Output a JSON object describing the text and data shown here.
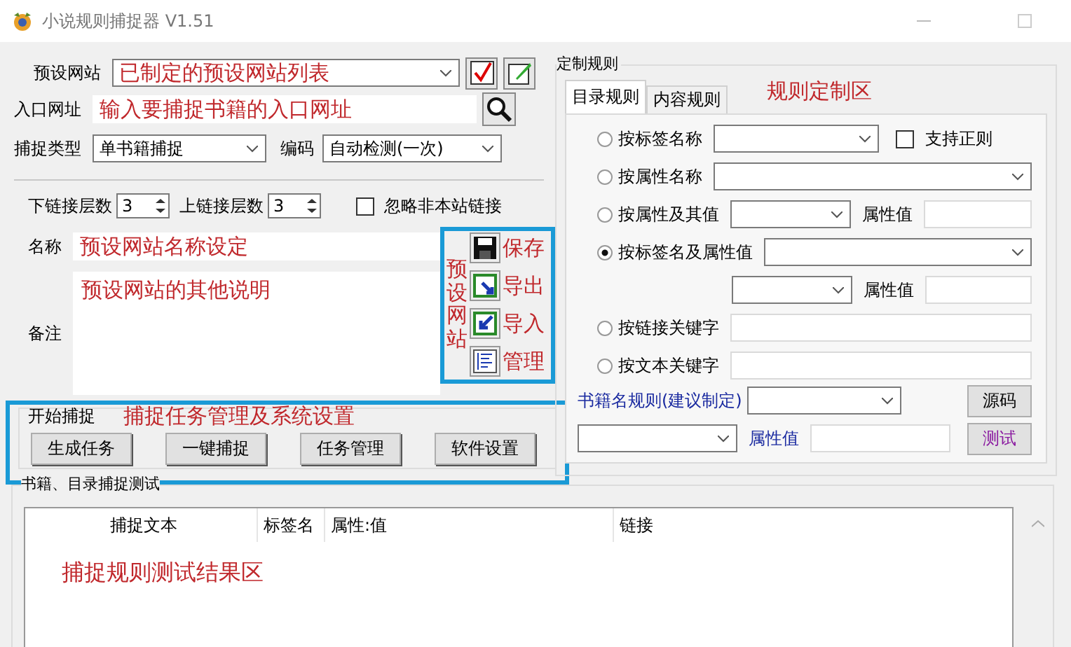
{
  "window": {
    "title": "小说规则捕捉器 V1.51"
  },
  "preset": {
    "label": "预设网站",
    "value": "已制定的预设网站列表"
  },
  "entry": {
    "label": "入口网址",
    "value": "输入要捕捉书籍的入口网址"
  },
  "capture_type": {
    "label": "捕捉类型",
    "value": "单书籍捕捉"
  },
  "encoding": {
    "label": "编码",
    "value": "自动检测(一次)"
  },
  "depth": {
    "down_label": "下链接层数",
    "down_value": "3",
    "up_label": "上链接层数",
    "up_value": "3",
    "ignore_label": "忽略非本站链接",
    "ignore_checked": false
  },
  "name": {
    "label": "名称",
    "value": "预设网站名称设定"
  },
  "note": {
    "label": "备注",
    "value": "预设网站的其他说明"
  },
  "preset_panel": {
    "title": "预设网站",
    "actions": [
      {
        "kind": "save",
        "label": "保存"
      },
      {
        "kind": "export",
        "label": "导出"
      },
      {
        "kind": "import",
        "label": "导入"
      },
      {
        "kind": "manage",
        "label": "管理"
      }
    ]
  },
  "start_group": {
    "title": "开始捕捉",
    "note": "捕捉任务管理及系统设置",
    "buttons": [
      "生成任务",
      "一键捕捉",
      "任务管理",
      "软件设置"
    ]
  },
  "rules": {
    "title": "定制规则",
    "note": "规则定制区",
    "tabs": [
      {
        "label": "目录规则",
        "selected": true
      },
      {
        "label": "内容规则",
        "selected": false
      }
    ],
    "options": [
      {
        "kind": "combo-check",
        "label": "按标签名称",
        "selected": false,
        "check_label": "支持正则",
        "checked": false
      },
      {
        "kind": "combo-wide",
        "label": "按属性名称",
        "selected": false
      },
      {
        "kind": "combo-attr",
        "label": "按属性及其值",
        "selected": false,
        "attr_label": "属性值"
      },
      {
        "kind": "combo-wide-attr",
        "label": "按标签名及属性值",
        "selected": true,
        "attr_label": "属性值"
      },
      {
        "kind": "text",
        "label": "按链接关键字",
        "selected": false
      },
      {
        "kind": "text",
        "label": "按文本关键字",
        "selected": false
      }
    ],
    "book_rule": {
      "label": "书籍名规则(建议制定)",
      "attr_label": "属性值",
      "buttons": [
        {
          "kind": "plain",
          "label": "源码"
        },
        {
          "kind": "accent",
          "label": "测试"
        }
      ]
    }
  },
  "test": {
    "title": "书籍、目录捕捉测试",
    "note": "捕捉规则测试结果区",
    "columns": [
      "捕捉文本",
      "标签名",
      "属性:值",
      "链接"
    ]
  }
}
